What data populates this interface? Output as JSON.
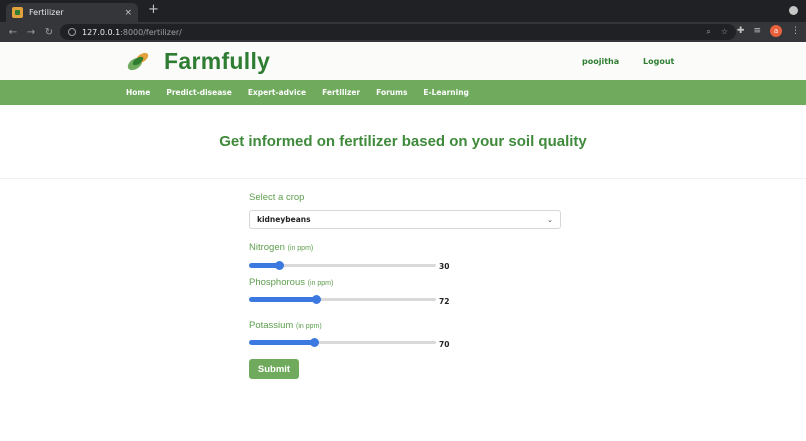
{
  "browser": {
    "tab_title": "Fertilizer",
    "tab_close": "×",
    "new_tab": "+",
    "url_host": "127.0.0.1",
    "url_rest": ":8000/fertilizer/",
    "avatar_initial": "a",
    "icons": [
      "back-icon",
      "forward-icon",
      "reload-icon",
      "info-icon",
      "search-icon",
      "star-icon",
      "extensions-icon",
      "reading-list-icon",
      "profile-avatar",
      "menu-icon"
    ]
  },
  "site": {
    "brand": "Farmfully",
    "user": "poojitha",
    "logout": "Logout",
    "brand_color": "#2e7d32",
    "nav_color": "#6faa5d",
    "nav": [
      "Home",
      "Predict-disease",
      "Expert-advice",
      "Fertilizer",
      "Forums",
      "E-Learning"
    ]
  },
  "page": {
    "headline": "Get informed on fertilizer based on your soil quality"
  },
  "form": {
    "crop_label": "Select a crop",
    "crop_value": "kidneybeans",
    "nitrogen": {
      "label": "Nitrogen",
      "unit": "(in ppm)",
      "value": "30",
      "fraction": 0.16
    },
    "phosphorous": {
      "label": "Phosphorous",
      "unit": "(in ppm)",
      "value": "72",
      "fraction": 0.36
    },
    "potassium": {
      "label": "Potassium",
      "unit": "(in ppm)",
      "value": "70",
      "fraction": 0.35
    },
    "submit": "Submit",
    "slider_color": "#3b79e0"
  }
}
